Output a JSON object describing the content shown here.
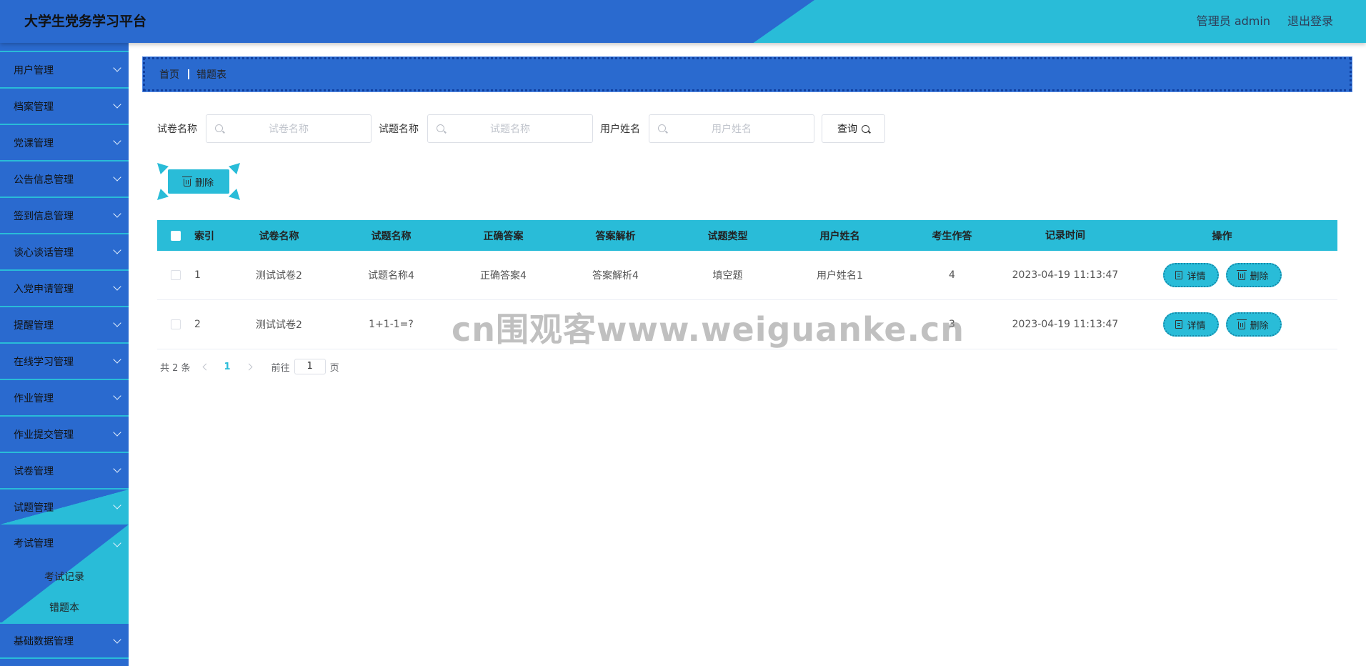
{
  "header": {
    "title": "大学生党务学习平台",
    "user_label": "管理员 admin",
    "logout_label": "退出登录"
  },
  "sidebar": {
    "items": [
      {
        "label": "用户管理"
      },
      {
        "label": "档案管理"
      },
      {
        "label": "党课管理"
      },
      {
        "label": "公告信息管理"
      },
      {
        "label": "签到信息管理"
      },
      {
        "label": "谈心谈话管理"
      },
      {
        "label": "入党申请管理"
      },
      {
        "label": "提醒管理"
      },
      {
        "label": "在线学习管理"
      },
      {
        "label": "作业管理"
      },
      {
        "label": "作业提交管理"
      },
      {
        "label": "试卷管理"
      },
      {
        "label": "试题管理"
      }
    ],
    "exam": {
      "label": "考试管理",
      "children": [
        {
          "label": "考试记录"
        },
        {
          "label": "错题本"
        }
      ]
    },
    "after": [
      {
        "label": "基础数据管理"
      }
    ]
  },
  "breadcrumb": {
    "home": "首页",
    "current": "错题表"
  },
  "search": {
    "paper_label": "试卷名称",
    "paper_placeholder": "试卷名称",
    "question_label": "试题名称",
    "question_placeholder": "试题名称",
    "user_label": "用户姓名",
    "user_placeholder": "用户姓名",
    "query_label": "查询"
  },
  "actions": {
    "batch_delete": "删除"
  },
  "table": {
    "headers": [
      "索引",
      "试卷名称",
      "试题名称",
      "正确答案",
      "答案解析",
      "试题类型",
      "用户姓名",
      "考生作答",
      "记录时间",
      "操作"
    ],
    "rows": [
      {
        "index": "1",
        "paper": "测试试卷2",
        "question": "试题名称4",
        "answer": "正确答案4",
        "analysis": "答案解析4",
        "type": "填空题",
        "user": "用户姓名1",
        "response": "4",
        "time": "2023-04-19 11:13:47"
      },
      {
        "index": "2",
        "paper": "测试试卷2",
        "question": "1+1-1=?",
        "answer": "",
        "analysis": "",
        "type": "",
        "user": "",
        "response": "3",
        "time": "2023-04-19 11:13:47"
      }
    ],
    "detail_label": "详情",
    "delete_label": "删除"
  },
  "pagination": {
    "total": "共 2 条",
    "current": "1",
    "goto_label": "前往",
    "goto_value": "1",
    "page_suffix": "页"
  },
  "watermark": "cn围观客www.weiguanke.cn",
  "colors": {
    "primary_blue": "#2a6acf",
    "accent_cyan": "#29bcd8"
  }
}
